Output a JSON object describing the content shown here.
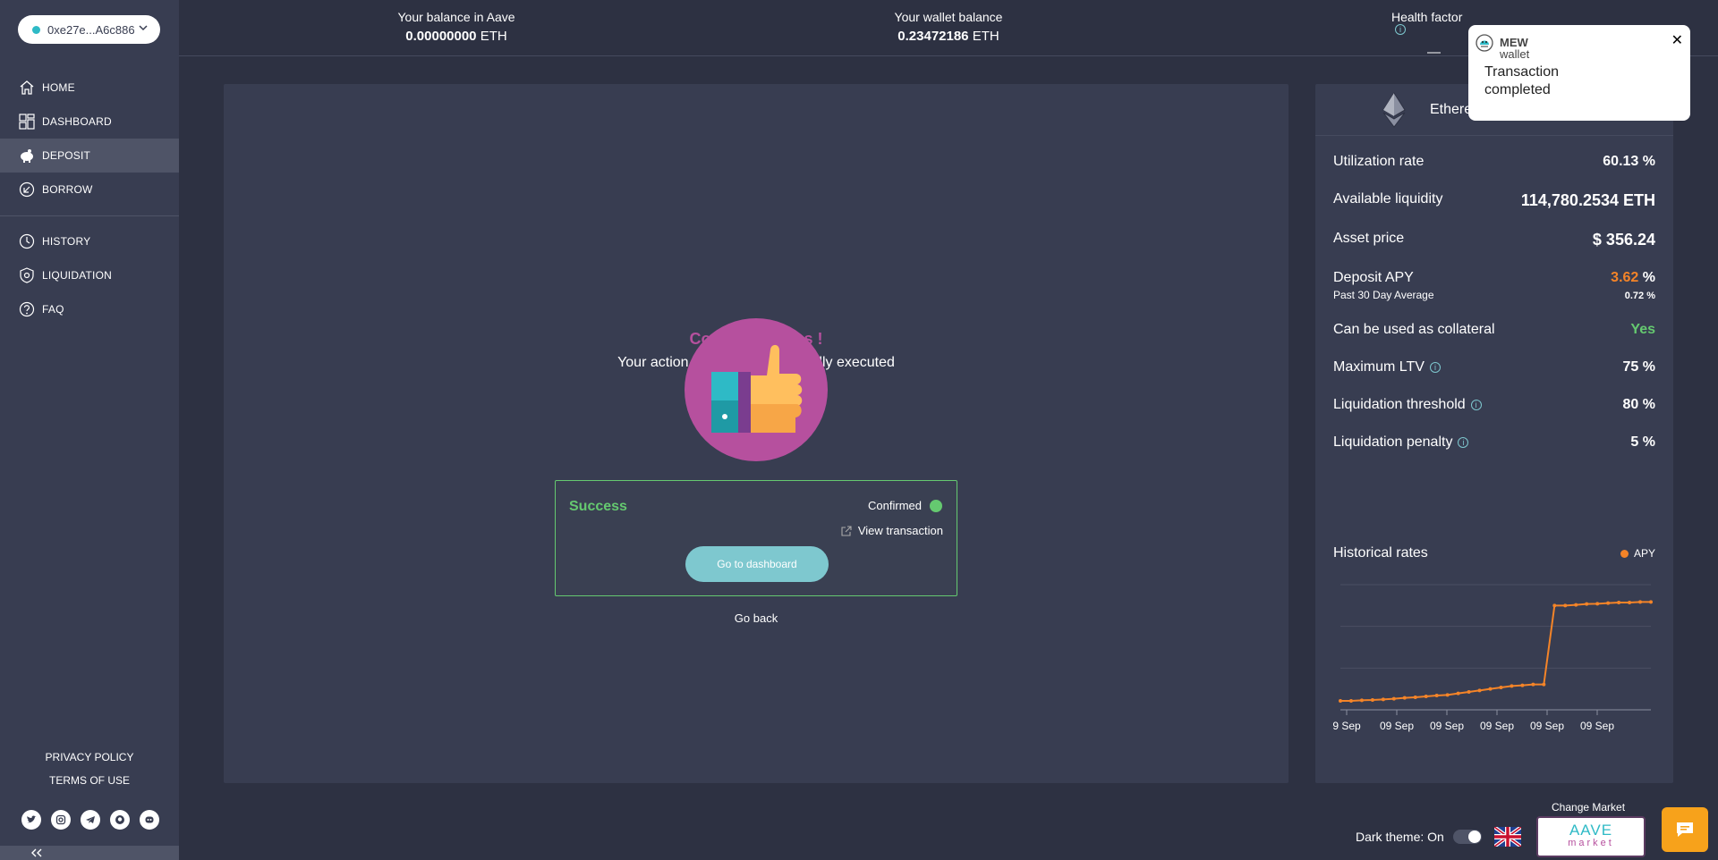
{
  "wallet": {
    "address": "0xe27e...A6c886"
  },
  "nav": {
    "home": "HOME",
    "dashboard": "DASHBOARD",
    "deposit": "DEPOSIT",
    "borrow": "BORROW",
    "history": "HISTORY",
    "liquidation": "LIQUIDATION",
    "faq": "FAQ"
  },
  "footer_links": {
    "privacy": "PRIVACY POLICY",
    "terms": "TERMS OF USE"
  },
  "topbar": {
    "aave_balance_label": "Your balance in Aave",
    "aave_balance_value": "0.00000000",
    "aave_balance_unit": "ETH",
    "wallet_balance_label": "Your wallet balance",
    "wallet_balance_value": "0.23472186",
    "wallet_balance_unit": "ETH",
    "health_label": "Health factor",
    "health_value": "—"
  },
  "result": {
    "title": "Congratulations !",
    "subtitle": "Your action has been successfully executed",
    "status": "Success",
    "confirmed": "Confirmed",
    "view_tx": "View transaction",
    "go_dashboard": "Go to dashboard",
    "go_back": "Go back"
  },
  "reserve": {
    "name": "Ethere",
    "rows": {
      "utilization_label": "Utilization rate",
      "utilization_value": "60.13 %",
      "liquidity_label": "Available liquidity",
      "liquidity_value": "114,780.2534 ETH",
      "price_label": "Asset price",
      "price_value": "$ 356.24",
      "deposit_apy_label": "Deposit APY",
      "deposit_apy_value": "3.62",
      "deposit_apy_unit": "%",
      "avg_label": "Past 30 Day Average",
      "avg_value": "0.72 %",
      "collateral_label": "Can be used as collateral",
      "collateral_value": "Yes",
      "ltv_label": "Maximum LTV",
      "ltv_value": "75 %",
      "threshold_label": "Liquidation threshold",
      "threshold_value": "80 %",
      "penalty_label": "Liquidation penalty",
      "penalty_value": "5 %"
    },
    "history_title": "Historical rates",
    "legend": "APY"
  },
  "chart_data": {
    "type": "line",
    "x": [
      "9 Sep",
      "09 Sep",
      "09 Sep",
      "09 Sep",
      "09 Sep",
      "09 Sep"
    ],
    "series": [
      {
        "name": "APY",
        "values": [
          0.3,
          0.3,
          0.32,
          0.33,
          0.35,
          0.37,
          0.4,
          0.42,
          0.45,
          0.48,
          0.5,
          0.55,
          0.6,
          0.65,
          0.7,
          0.75,
          0.8,
          0.82,
          0.85,
          0.85,
          3.5,
          3.5,
          3.52,
          3.55,
          3.56,
          3.58,
          3.6,
          3.6,
          3.62,
          3.62
        ]
      }
    ],
    "tick_labels": [
      "9 Sep",
      "09 Sep",
      "09 Sep",
      "09 Sep",
      "09 Sep",
      "09 Sep"
    ],
    "grid": true,
    "colors": {
      "line": "#f48428"
    }
  },
  "toast": {
    "brand_line1": "MEW",
    "brand_line2": "wallet",
    "message_line1": "Transaction",
    "message_line2": "completed",
    "close": "✕"
  },
  "footer": {
    "dark_theme": "Dark theme: On",
    "change_market": "Change Market",
    "market_line1": "AAVE",
    "market_line2": "market"
  },
  "colors": {
    "accent_pink": "#b6509e",
    "accent_teal": "#2ebac6",
    "success_green": "#65c970",
    "apy_orange": "#f48428"
  }
}
